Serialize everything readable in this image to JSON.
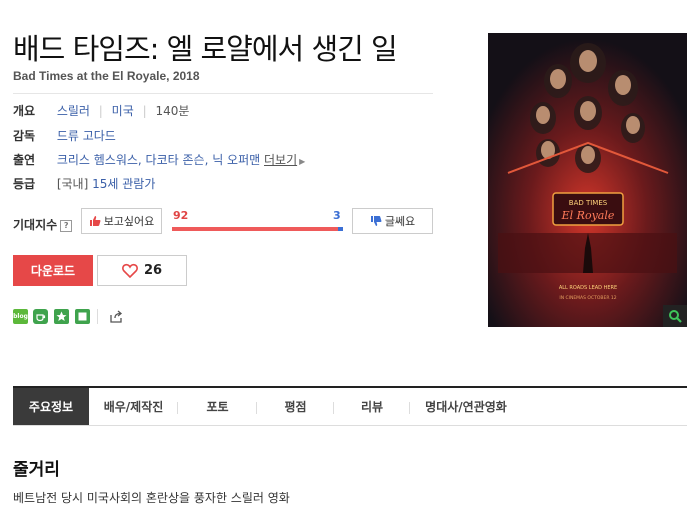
{
  "movie": {
    "title": "배드 타임즈: 엘 로얄에서 생긴 일",
    "original_title_year": "Bad Times at the El Royale, 2018"
  },
  "info": {
    "overview_label": "개요",
    "genre": "스릴러",
    "country": "미국",
    "runtime": "140분",
    "director_label": "감독",
    "director": "드류 고다드",
    "cast_label": "출연",
    "cast": "크리스 헴스워스, 다코타 존슨, 닉 오퍼맨",
    "cast_more": "더보기",
    "rating_label": "등급",
    "rating_region": "[국내]",
    "rating": "15세 관람가"
  },
  "expectation": {
    "label": "기대지수",
    "help": "?",
    "want_label": "보고싶어요",
    "want_count": "92",
    "notwant_label": "글쎄요",
    "notwant_count": "3",
    "want_fraction": 0.968
  },
  "actions": {
    "download_label": "다운로드",
    "like_count": "26"
  },
  "share": {
    "blog_label": "blog"
  },
  "poster": {
    "tagline_1": "ALL ROADS LEAD HERE",
    "tagline_2": "IN CINEMAS OCTOBER 12",
    "sign_1": "BAD TIMES",
    "sign_2": "El Royale"
  },
  "tabs": [
    {
      "label": "주요정보",
      "active": true
    },
    {
      "label": "배우/제작진",
      "active": false
    },
    {
      "label": "포토",
      "active": false
    },
    {
      "label": "평점",
      "active": false
    },
    {
      "label": "리뷰",
      "active": false
    },
    {
      "label": "명대사/연관영화",
      "active": false
    }
  ],
  "synopsis": {
    "title": "줄거리",
    "text": "베트남전 당시 미국사회의 혼란상을 풍자한 스릴러 영화"
  },
  "colors": {
    "accent_red": "#e64848",
    "link_blue": "#3a5fa8",
    "bar_blue": "#3b6fd4"
  }
}
